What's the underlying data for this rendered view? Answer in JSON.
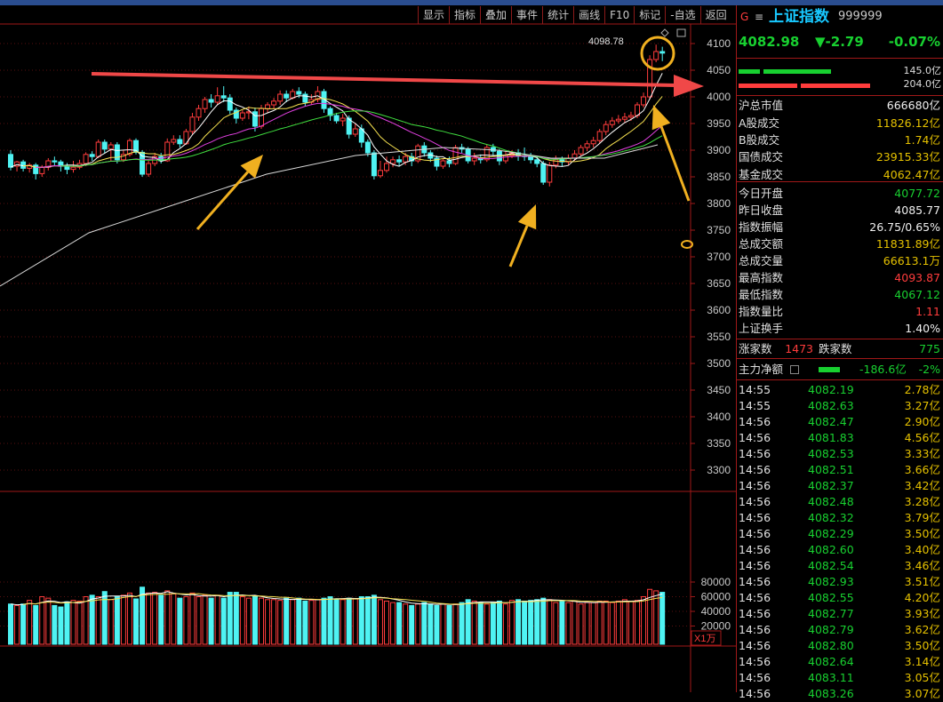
{
  "toolbar": {
    "items": [
      "显示",
      "指标",
      "叠加",
      "事件",
      "统计",
      "画线",
      "F10",
      "标记",
      "-自选",
      "返回"
    ]
  },
  "quote": {
    "g_mark": "G",
    "menu_mark": "≡",
    "name": "上证指数",
    "code": "999999",
    "price": "4082.98",
    "change": "▼-2.79",
    "pct": "-0.07%",
    "bar1_value": "145.0亿",
    "bar2_value": "204.0亿"
  },
  "stats": [
    {
      "label": "沪总市值",
      "value": "666680亿",
      "color": "w"
    },
    {
      "label": "A股成交",
      "value": "11826.12亿",
      "color": "y"
    },
    {
      "label": "B股成交",
      "value": "1.74亿",
      "color": "y"
    },
    {
      "label": "国债成交",
      "value": "23915.33亿",
      "color": "y"
    },
    {
      "label": "基金成交",
      "value": "4062.47亿",
      "color": "y"
    },
    {
      "label": "今日开盘",
      "value": "4077.72",
      "color": "g"
    },
    {
      "label": "昨日收盘",
      "value": "4085.77",
      "color": "w"
    },
    {
      "label": "指数振幅",
      "value": "26.75/0.65%",
      "color": "w"
    },
    {
      "label": "总成交额",
      "value": "11831.89亿",
      "color": "y"
    },
    {
      "label": "总成交量",
      "value": "66613.1万",
      "color": "y"
    },
    {
      "label": "最高指数",
      "value": "4093.87",
      "color": "r"
    },
    {
      "label": "最低指数",
      "value": "4067.12",
      "color": "g"
    },
    {
      "label": "指数量比",
      "value": "1.11",
      "color": "r"
    },
    {
      "label": "上证换手",
      "value": "1.40%",
      "color": "w"
    }
  ],
  "breadth": {
    "up_label": "涨家数",
    "up": "1473",
    "down_label": "跌家数",
    "down": "775"
  },
  "mainflow": {
    "label": "主力净额",
    "value": "-186.6亿",
    "pct": "-2%"
  },
  "ticks": [
    [
      "14:55",
      "4082.19",
      "2.78亿"
    ],
    [
      "14:55",
      "4082.63",
      "3.27亿"
    ],
    [
      "14:56",
      "4082.47",
      "2.90亿"
    ],
    [
      "14:56",
      "4081.83",
      "4.56亿"
    ],
    [
      "14:56",
      "4082.53",
      "3.33亿"
    ],
    [
      "14:56",
      "4082.51",
      "3.66亿"
    ],
    [
      "14:56",
      "4082.37",
      "3.42亿"
    ],
    [
      "14:56",
      "4082.48",
      "3.28亿"
    ],
    [
      "14:56",
      "4082.32",
      "3.79亿"
    ],
    [
      "14:56",
      "4082.29",
      "3.50亿"
    ],
    [
      "14:56",
      "4082.60",
      "3.40亿"
    ],
    [
      "14:56",
      "4082.54",
      "3.46亿"
    ],
    [
      "14:56",
      "4082.93",
      "3.51亿"
    ],
    [
      "14:56",
      "4082.55",
      "4.20亿"
    ],
    [
      "14:56",
      "4082.77",
      "3.93亿"
    ],
    [
      "14:56",
      "4082.79",
      "3.62亿"
    ],
    [
      "14:56",
      "4082.80",
      "3.50亿"
    ],
    [
      "14:56",
      "4082.64",
      "3.14亿"
    ],
    [
      "14:56",
      "4083.11",
      "3.05亿"
    ],
    [
      "14:56",
      "4083.26",
      "3.07亿"
    ]
  ],
  "chart": {
    "price_axis": [
      "4100",
      "4050",
      "4000",
      "3950",
      "3900",
      "3850",
      "3800",
      "3750",
      "3700",
      "3650",
      "3600",
      "3550",
      "3500",
      "3450",
      "3400",
      "3350",
      "3300"
    ],
    "vol_axis": [
      "80000",
      "60000",
      "40000",
      "20000"
    ],
    "vol_unit": "X1万",
    "high_label": "4098.78",
    "candles": [
      [
        3892,
        3868,
        3900,
        3862,
        50000
      ],
      [
        3870,
        3878,
        3880,
        3860,
        48000
      ],
      [
        3878,
        3866,
        3882,
        3860,
        50000
      ],
      [
        3866,
        3872,
        3876,
        3858,
        55000
      ],
      [
        3872,
        3856,
        3876,
        3845,
        48000
      ],
      [
        3856,
        3868,
        3872,
        3850,
        60000
      ],
      [
        3868,
        3880,
        3885,
        3862,
        58000
      ],
      [
        3880,
        3878,
        3888,
        3870,
        48000
      ],
      [
        3878,
        3870,
        3882,
        3860,
        46000
      ],
      [
        3870,
        3864,
        3876,
        3855,
        53000
      ],
      [
        3864,
        3868,
        3880,
        3858,
        55000
      ],
      [
        3868,
        3875,
        3882,
        3864,
        54000
      ],
      [
        3875,
        3892,
        3896,
        3870,
        60000
      ],
      [
        3892,
        3888,
        3898,
        3880,
        62000
      ],
      [
        3888,
        3915,
        3920,
        3885,
        60000
      ],
      [
        3915,
        3902,
        3920,
        3895,
        67000
      ],
      [
        3902,
        3910,
        3915,
        3880,
        56000
      ],
      [
        3910,
        3882,
        3915,
        3875,
        60000
      ],
      [
        3882,
        3892,
        3900,
        3878,
        62000
      ],
      [
        3892,
        3918,
        3922,
        3888,
        65000
      ],
      [
        3918,
        3896,
        3922,
        3892,
        57000
      ],
      [
        3896,
        3855,
        3900,
        3850,
        73000
      ],
      [
        3855,
        3875,
        3880,
        3850,
        65000
      ],
      [
        3875,
        3888,
        3895,
        3870,
        66000
      ],
      [
        3888,
        3880,
        3895,
        3875,
        62000
      ],
      [
        3880,
        3915,
        3922,
        3878,
        68000
      ],
      [
        3915,
        3920,
        3928,
        3910,
        64000
      ],
      [
        3920,
        3912,
        3928,
        3905,
        58000
      ],
      [
        3912,
        3935,
        3940,
        3910,
        60000
      ],
      [
        3935,
        3962,
        3970,
        3930,
        65000
      ],
      [
        3962,
        3978,
        3985,
        3955,
        60000
      ],
      [
        3978,
        3995,
        4000,
        3970,
        62000
      ],
      [
        3995,
        3990,
        4005,
        3980,
        58000
      ],
      [
        3990,
        4002,
        4018,
        3985,
        62000
      ],
      [
        4002,
        3998,
        4020,
        3990,
        58000
      ],
      [
        3998,
        3975,
        4005,
        3968,
        66000
      ],
      [
        3975,
        3960,
        3980,
        3950,
        66000
      ],
      [
        3960,
        3970,
        3975,
        3955,
        60000
      ],
      [
        3970,
        3972,
        3982,
        3958,
        58000
      ],
      [
        3972,
        3945,
        3980,
        3935,
        60000
      ],
      [
        3945,
        3978,
        3985,
        3940,
        58000
      ],
      [
        3978,
        3985,
        3990,
        3970,
        56000
      ],
      [
        3985,
        3992,
        3998,
        3978,
        56000
      ],
      [
        3992,
        4005,
        4012,
        3985,
        55000
      ],
      [
        4005,
        3998,
        4012,
        3990,
        58000
      ],
      [
        3998,
        4010,
        4015,
        3995,
        56000
      ],
      [
        4010,
        4005,
        4018,
        3998,
        58000
      ],
      [
        4005,
        3990,
        4010,
        3982,
        54000
      ],
      [
        3990,
        3995,
        4005,
        3985,
        55000
      ],
      [
        3995,
        4010,
        4020,
        3990,
        56000
      ],
      [
        4010,
        3978,
        4015,
        3970,
        58000
      ],
      [
        3978,
        3965,
        3982,
        3955,
        60000
      ],
      [
        3965,
        3955,
        3970,
        3950,
        57000
      ],
      [
        3955,
        3960,
        3968,
        3945,
        56000
      ],
      [
        3960,
        3930,
        3965,
        3922,
        58000
      ],
      [
        3930,
        3940,
        3950,
        3925,
        57000
      ],
      [
        3940,
        3915,
        3948,
        3905,
        60000
      ],
      [
        3915,
        3895,
        3920,
        3888,
        60000
      ],
      [
        3895,
        3852,
        3900,
        3845,
        62000
      ],
      [
        3852,
        3862,
        3880,
        3848,
        56000
      ],
      [
        3862,
        3875,
        3888,
        3858,
        54000
      ],
      [
        3875,
        3882,
        3888,
        3868,
        52000
      ],
      [
        3882,
        3878,
        3890,
        3870,
        52000
      ],
      [
        3878,
        3888,
        3895,
        3872,
        50000
      ],
      [
        3888,
        3880,
        3895,
        3870,
        48000
      ],
      [
        3880,
        3908,
        3912,
        3876,
        50000
      ],
      [
        3908,
        3895,
        3915,
        3888,
        52000
      ],
      [
        3895,
        3885,
        3900,
        3878,
        50000
      ],
      [
        3885,
        3870,
        3890,
        3862,
        48000
      ],
      [
        3870,
        3880,
        3885,
        3865,
        50000
      ],
      [
        3880,
        3875,
        3888,
        3868,
        48000
      ],
      [
        3875,
        3905,
        3910,
        3872,
        50000
      ],
      [
        3905,
        3902,
        3912,
        3895,
        52000
      ],
      [
        3902,
        3880,
        3906,
        3875,
        56000
      ],
      [
        3880,
        3885,
        3895,
        3872,
        54000
      ],
      [
        3885,
        3882,
        3892,
        3875,
        52000
      ],
      [
        3882,
        3905,
        3910,
        3878,
        50000
      ],
      [
        3905,
        3898,
        3912,
        3890,
        52000
      ],
      [
        3898,
        3880,
        3902,
        3872,
        54000
      ],
      [
        3880,
        3890,
        3898,
        3875,
        50000
      ],
      [
        3890,
        3895,
        3900,
        3885,
        55000
      ],
      [
        3895,
        3890,
        3902,
        3880,
        56000
      ],
      [
        3890,
        3888,
        3905,
        3880,
        54000
      ],
      [
        3888,
        3882,
        3895,
        3875,
        55000
      ],
      [
        3882,
        3875,
        3888,
        3868,
        56000
      ],
      [
        3875,
        3840,
        3880,
        3835,
        58000
      ],
      [
        3840,
        3872,
        3878,
        3832,
        56000
      ],
      [
        3872,
        3882,
        3890,
        3866,
        52000
      ],
      [
        3882,
        3878,
        3888,
        3870,
        54000
      ],
      [
        3878,
        3885,
        3892,
        3872,
        52000
      ],
      [
        3885,
        3893,
        3900,
        3880,
        54000
      ],
      [
        3893,
        3905,
        3910,
        3888,
        50000
      ],
      [
        3905,
        3912,
        3918,
        3898,
        52000
      ],
      [
        3912,
        3918,
        3925,
        3905,
        52000
      ],
      [
        3918,
        3935,
        3940,
        3912,
        54000
      ],
      [
        3935,
        3948,
        3955,
        3928,
        54000
      ],
      [
        3948,
        3955,
        3962,
        3942,
        52000
      ],
      [
        3955,
        3958,
        3966,
        3950,
        54000
      ],
      [
        3958,
        3962,
        3970,
        3952,
        56000
      ],
      [
        3962,
        3965,
        3972,
        3955,
        54000
      ],
      [
        3965,
        3985,
        3990,
        3960,
        55000
      ],
      [
        3985,
        4000,
        4008,
        3980,
        60000
      ],
      [
        4000,
        4070,
        4078,
        3995,
        70000
      ],
      [
        4070,
        4085,
        4098,
        4065,
        68000
      ],
      [
        4085,
        4082,
        4094,
        4067,
        66000
      ]
    ]
  }
}
